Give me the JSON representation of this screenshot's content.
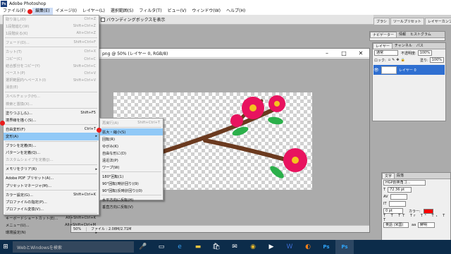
{
  "app": {
    "title": "Adobe Photoshop",
    "logo": "Ps"
  },
  "menubar": [
    "ファイル(F)",
    "編集(E)",
    "イメージ(I)",
    "レイヤー(L)",
    "選択範囲(S)",
    "フィルタ(T)",
    "ビュー(V)",
    "ウィンドウ(W)",
    "ヘルプ(H)"
  ],
  "options_bar": {
    "checkbox_label": "バウンディングボックスを表示"
  },
  "palette_well": [
    "ブラシ",
    "ツールプリセット",
    "レイヤーカンプ"
  ],
  "document": {
    "title": "png @ 50% (レイヤー 0, RGB/8)",
    "zoom": "50%",
    "file_info": "ファイル : 2.08M/2.71M"
  },
  "edit_menu": [
    {
      "label": "取り消し(O)",
      "shortcut": "Ctrl+Z",
      "disabled": true
    },
    {
      "label": "1段階進む(W)",
      "shortcut": "Shift+Ctrl+Z",
      "disabled": true
    },
    {
      "label": "1段階戻る(K)",
      "shortcut": "Alt+Ctrl+Z",
      "disabled": true
    },
    {
      "sep": true
    },
    {
      "label": "フェード(D)...",
      "shortcut": "Shift+Ctrl+F",
      "disabled": true
    },
    {
      "sep": true
    },
    {
      "label": "カット(T)",
      "shortcut": "Ctrl+X",
      "disabled": true
    },
    {
      "label": "コピー(C)",
      "shortcut": "Ctrl+C",
      "disabled": true
    },
    {
      "label": "結合部分をコピー(Y)",
      "shortcut": "Shift+Ctrl+C",
      "disabled": true
    },
    {
      "label": "ペースト(P)",
      "shortcut": "Ctrl+V",
      "disabled": true
    },
    {
      "label": "選択範囲内へペースト(I)",
      "shortcut": "Shift+Ctrl+V",
      "disabled": true
    },
    {
      "label": "消去(E)",
      "shortcut": "",
      "disabled": true
    },
    {
      "sep": true
    },
    {
      "label": "スペルチェック(H)...",
      "shortcut": "",
      "disabled": true
    },
    {
      "label": "検索と置換(X)...",
      "shortcut": "",
      "disabled": true
    },
    {
      "sep": true
    },
    {
      "label": "塗りつぶし(L)...",
      "shortcut": "Shift+F5",
      "disabled": false
    },
    {
      "label": "境界線を描く(S)...",
      "shortcut": "",
      "disabled": false
    },
    {
      "sep": true
    },
    {
      "label": "自由変形(F)",
      "shortcut": "Ctrl+T",
      "disabled": false
    },
    {
      "label": "変形(A)",
      "shortcut": "",
      "disabled": false,
      "highlight": true,
      "submenu": true
    },
    {
      "sep": true
    },
    {
      "label": "ブラシを定義(B)...",
      "shortcut": "",
      "disabled": false
    },
    {
      "label": "パターンを定義(Q)...",
      "shortcut": "",
      "disabled": false
    },
    {
      "label": "カスタムシェイプを定義(J)...",
      "shortcut": "",
      "disabled": true
    },
    {
      "sep": true
    },
    {
      "label": "メモリをクリア(R)",
      "shortcut": "",
      "disabled": false,
      "submenu": true
    },
    {
      "sep": true
    },
    {
      "label": "Adobe PDF プリセット(A)...",
      "shortcut": "",
      "disabled": false
    },
    {
      "label": "プリセットマネージャ(M)...",
      "shortcut": "",
      "disabled": false
    },
    {
      "sep": true
    },
    {
      "label": "カラー設定(G)...",
      "shortcut": "Shift+Ctrl+K",
      "disabled": false
    },
    {
      "label": "プロファイルの指定(P)...",
      "shortcut": "",
      "disabled": false
    },
    {
      "label": "プロファイル変換(V)...",
      "shortcut": "",
      "disabled": false
    },
    {
      "sep": true
    },
    {
      "label": "キーボードショートカット(E)...",
      "shortcut": "Alt+Shift+Ctrl+K",
      "disabled": false
    },
    {
      "label": "メニュー(U)...",
      "shortcut": "Alt+Shift+Ctrl+M",
      "disabled": false
    },
    {
      "label": "環境設定(N)",
      "shortcut": "",
      "disabled": false,
      "submenu": true
    }
  ],
  "transform_submenu": [
    {
      "label": "再実行(A)",
      "shortcut": "Shift+Ctrl+T",
      "disabled": true
    },
    {
      "sep": true
    },
    {
      "label": "拡大・縮小(S)",
      "shortcut": "",
      "disabled": false,
      "highlight": true
    },
    {
      "label": "回転(R)",
      "shortcut": "",
      "disabled": false
    },
    {
      "label": "ゆがみ(K)",
      "shortcut": "",
      "disabled": false
    },
    {
      "label": "自由な形に(D)",
      "shortcut": "",
      "disabled": false
    },
    {
      "label": "遠近法(P)",
      "shortcut": "",
      "disabled": false
    },
    {
      "label": "ワープ(W)",
      "shortcut": "",
      "disabled": false
    },
    {
      "sep": true
    },
    {
      "label": "180°回転(1)",
      "shortcut": "",
      "disabled": false
    },
    {
      "label": "90°回転(時計回り)(9)",
      "shortcut": "",
      "disabled": false
    },
    {
      "label": "90°回転(反時計回り)(0)",
      "shortcut": "",
      "disabled": false
    },
    {
      "sep": true
    },
    {
      "label": "水平方向に反転(H)",
      "shortcut": "",
      "disabled": false
    },
    {
      "label": "垂直方向に反転(V)",
      "shortcut": "",
      "disabled": false
    }
  ],
  "navigator_tabs": [
    "ナビゲーター",
    "情報",
    "ヒストグラム"
  ],
  "layers_panel": {
    "tabs": [
      "レイヤー",
      "チャンネル",
      "パス"
    ],
    "blend_mode": "通常",
    "opacity_label": "不透明度:",
    "opacity": "100%",
    "lock_label": "ロック:",
    "fill_label": "塗り:",
    "fill": "100%",
    "layer_name": "レイヤー 0"
  },
  "char_panel": {
    "tabs": [
      "文字",
      "段落"
    ],
    "font": "HGP創英角ゴ...",
    "size": "72.36 pt",
    "tracking": "0 pt",
    "color_label": "カラー:",
    "aa_label": "aa",
    "aa_mode": "鮮明",
    "lang": "英語 (米国)",
    "color": "#ff0000"
  },
  "taskbar": {
    "search_placeholder": "WebとWindowsを検索"
  },
  "colors": {
    "flower": "#e8135f",
    "branch": "#6b3a1f",
    "leaf": "#2bb04a",
    "stamen": "#f4c31f",
    "highlight": "#91c9f7",
    "accent_dot": "#e81c1c"
  }
}
